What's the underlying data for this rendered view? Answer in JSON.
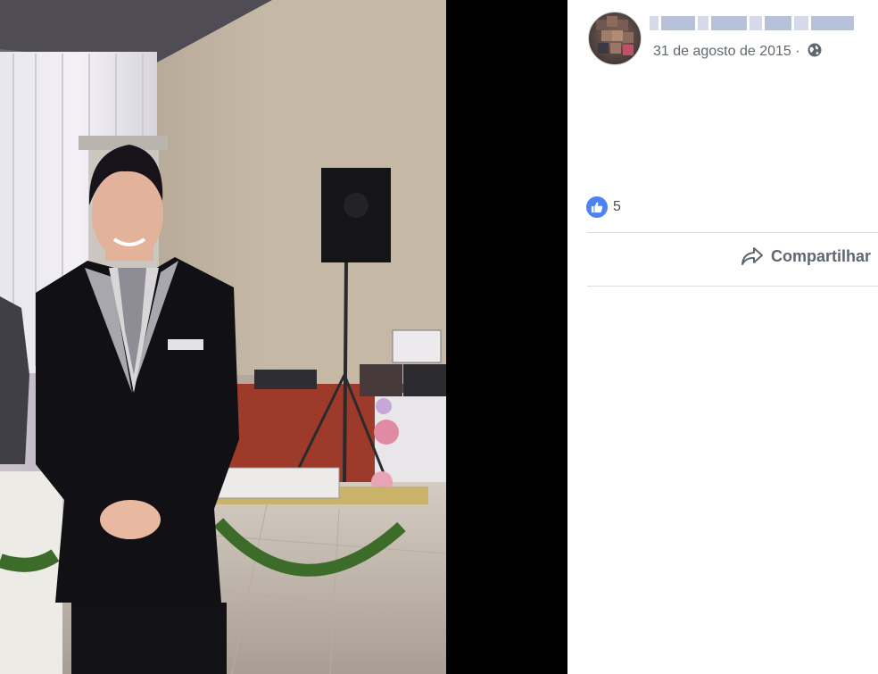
{
  "post": {
    "date": "31 de agosto de 2015",
    "separator": "·",
    "privacy_icon": "globe-icon"
  },
  "reactions": {
    "icon": "like-icon",
    "count": "5"
  },
  "actions": {
    "share_label": "Compartilhar",
    "share_icon": "share-arrow-icon"
  },
  "colors": {
    "like_blue": "#4d82f3",
    "text_gray": "#616770",
    "divider": "#dadde1",
    "name_blur": "#aab6d3"
  }
}
